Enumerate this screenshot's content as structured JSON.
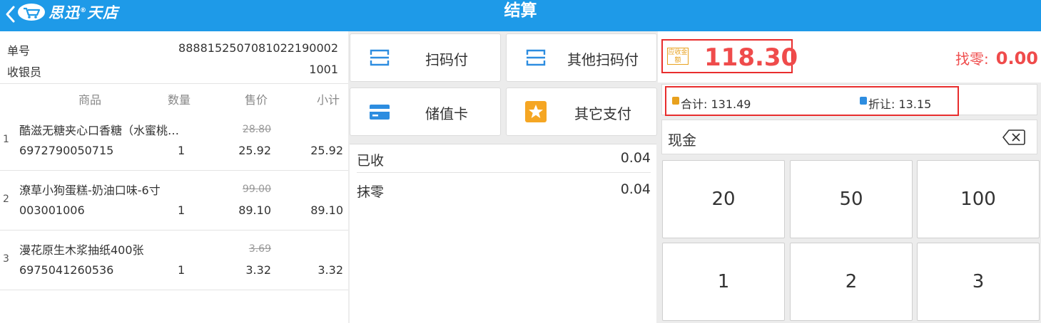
{
  "header": {
    "brand_main": "思迅",
    "brand_reg": "®",
    "brand_sub": "天店",
    "title": "结算"
  },
  "order": {
    "number_label": "单号",
    "number_value": "8888152507081022190002",
    "cashier_label": "收银员",
    "cashier_value": "1001"
  },
  "columns": {
    "product": "商品",
    "qty": "数量",
    "price": "售价",
    "subtotal": "小计"
  },
  "items": [
    {
      "index": "1",
      "name": "酷滋无糖夹心口香糖（水蜜桃…",
      "original_price": "28.80",
      "code": "6972790050715",
      "qty": "1",
      "price": "25.92",
      "subtotal": "25.92"
    },
    {
      "index": "2",
      "name": "潦草小狗蛋糕-奶油口味-6寸",
      "original_price": "99.00",
      "code": "003001006",
      "qty": "1",
      "price": "89.10",
      "subtotal": "89.10"
    },
    {
      "index": "3",
      "name": "漫花原生木浆抽纸400张",
      "original_price": "3.69",
      "code": "6975041260536",
      "qty": "1",
      "price": "3.32",
      "subtotal": "3.32"
    }
  ],
  "payment_methods": {
    "scan_pay": "扫码付",
    "other_scan_pay": "其他扫码付",
    "stored_card": "储值卡",
    "other_pay": "其它支付"
  },
  "received": {
    "received_label": "已收",
    "received_value": "0.04",
    "rounding_label": "抹零",
    "rounding_value": "0.04"
  },
  "amounts": {
    "due_badge": "应收金额",
    "due_value": "118.30",
    "change_label": "找零:",
    "change_value": "0.00",
    "total_label": "合计:",
    "total_value": "131.49",
    "discount_label": "折让:",
    "discount_value": "13.15",
    "cash_label": "现金"
  },
  "keypad": [
    "20",
    "50",
    "100",
    "1",
    "2",
    "3"
  ],
  "colors": {
    "header_blue": "#1e9ae8",
    "alert_red": "#ef4b4b",
    "highlight_border": "#e82d2d",
    "badge_orange": "#e8a11e",
    "icon_blue": "#2d8de0",
    "star_orange": "#f5a623"
  }
}
